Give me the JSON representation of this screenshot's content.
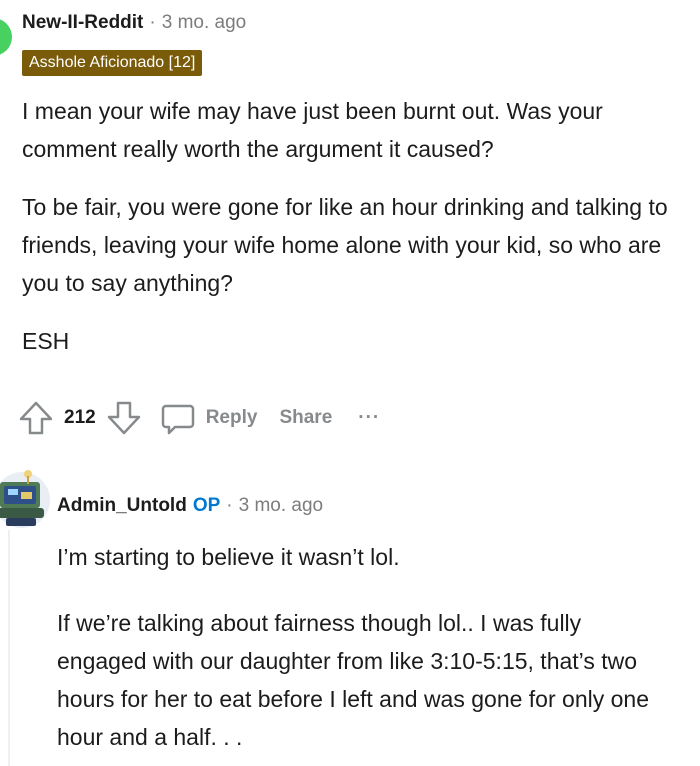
{
  "comment": {
    "author": "New-II-Reddit",
    "separator": "·",
    "time": "3 mo. ago",
    "flair": "Asshole Aficionado [12]",
    "paragraphs": [
      "I mean your wife may have just been burnt out. Was your comment really worth the argument it caused?",
      "To be fair, you were gone for like an hour drinking and talking to friends, leaving your wife home alone with your kid, so who are you to say anything?",
      "ESH"
    ],
    "score": "212",
    "reply_label": "Reply",
    "share_label": "Share",
    "more_label": "···"
  },
  "reply": {
    "author": "Admin_Untold",
    "op_badge": "OP",
    "separator": "·",
    "time": "3 mo. ago",
    "paragraphs": [
      "I’m starting to believe it wasn’t lol.",
      "If we’re talking about fairness though lol.. I was fully engaged with our daughter from like 3:10-5:15, that’s two hours for her to eat before I left and was gone for only one hour and a half. . ."
    ]
  },
  "colors": {
    "flair_bg": "#7a5b0a",
    "op_blue": "#0079d3",
    "muted": "#878a8c",
    "avatar_green": "#46d160"
  },
  "icons": [
    "upvote-icon",
    "downvote-icon",
    "comment-bubble-icon",
    "more-icon",
    "avatar-icon"
  ]
}
